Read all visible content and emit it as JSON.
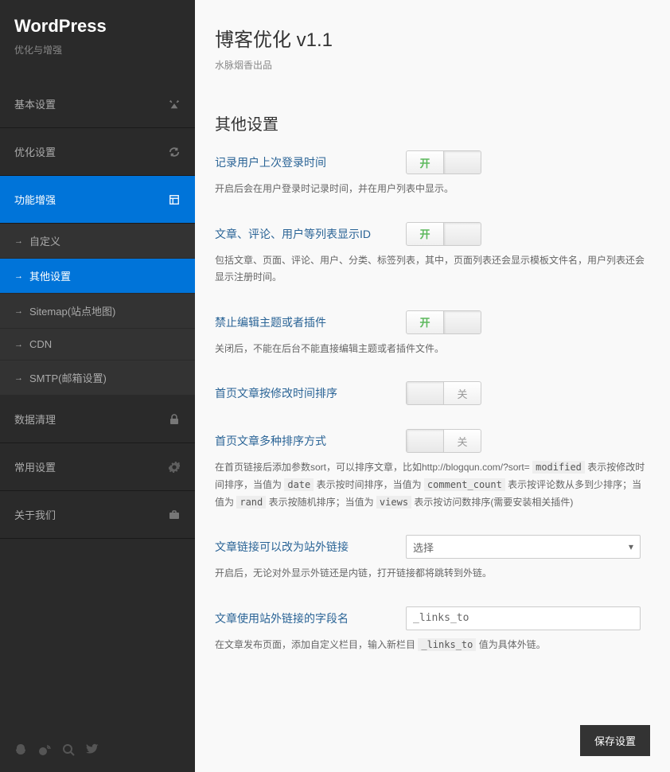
{
  "sidebar": {
    "title": "WordPress",
    "subtitle": "优化与增强",
    "items": [
      {
        "label": "基本设置",
        "icon": "tools"
      },
      {
        "label": "优化设置",
        "icon": "refresh"
      },
      {
        "label": "功能增强",
        "icon": "layout",
        "active": true
      },
      {
        "label": "数据清理",
        "icon": "lock"
      },
      {
        "label": "常用设置",
        "icon": "gear"
      },
      {
        "label": "关于我们",
        "icon": "briefcase"
      }
    ],
    "subitems": [
      {
        "label": "自定义"
      },
      {
        "label": "其他设置",
        "active": true
      },
      {
        "label": "Sitemap(站点地图)"
      },
      {
        "label": "CDN"
      },
      {
        "label": "SMTP(邮箱设置)"
      }
    ]
  },
  "header": {
    "title": "博客优化 v1.1",
    "subtitle": "水脉烟香出品"
  },
  "section_title": "其他设置",
  "toggle_text": {
    "on": "开",
    "off": "关"
  },
  "settings": [
    {
      "label": "记录用户上次登录时间",
      "desc": "开启后会在用户登录时记录时间，并在用户列表中显示。",
      "type": "toggle",
      "state": "on"
    },
    {
      "label": "文章、评论、用户等列表显示ID",
      "desc": "包括文章、页面、评论、用户、分类、标签列表，其中，页面列表还会显示模板文件名，用户列表还会显示注册时间。",
      "type": "toggle",
      "state": "on"
    },
    {
      "label": "禁止编辑主题或者插件",
      "desc": "关闭后，不能在后台不能直接编辑主题或者插件文件。",
      "type": "toggle",
      "state": "on"
    },
    {
      "label": "首页文章按修改时间排序",
      "desc": "",
      "type": "toggle",
      "state": "off"
    },
    {
      "label": "首页文章多种排序方式",
      "desc_html": "在首页链接后添加参数sort，可以排序文章，比如http://blogqun.com/?sort= <code>modified</code> 表示按修改时间排序，当值为 <code>date</code> 表示按时间排序，当值为 <code>comment_count</code> 表示按评论数从多到少排序；当值为 <code>rand</code> 表示按随机排序；当值为 <code>views</code> 表示按访问数排序(需要安装相关插件)",
      "type": "toggle",
      "state": "off"
    },
    {
      "label": "文章链接可以改为站外链接",
      "desc": "开启后，无论对外显示外链还是内链，打开链接都将跳转到外链。",
      "type": "select",
      "value": "选择"
    },
    {
      "label": "文章使用站外链接的字段名",
      "desc_html": "在文章发布页面，添加自定义栏目，输入新栏目 <code>_links_to</code> 值为具体外链。",
      "type": "text",
      "value": "_links_to"
    }
  ],
  "save_button": "保存设置"
}
